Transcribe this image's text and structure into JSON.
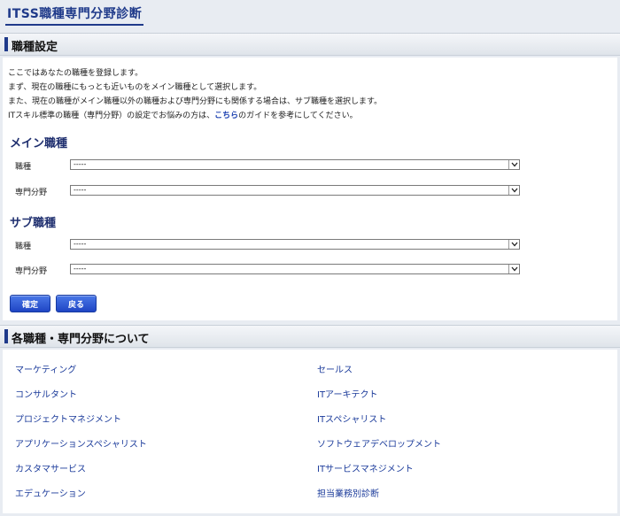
{
  "app": {
    "title": "ITSS職種専門分野診断"
  },
  "section1": {
    "heading": "職種設定",
    "intro": {
      "line1": "ここではあなたの職種を登録します。",
      "line2": "まず、現在の職種にもっとも近いものをメイン職種として選択します。",
      "line3": "また、現在の職種がメイン職種以外の職種および専門分野にも関係する場合は、サブ職種を選択します。",
      "line4_pre": "ITスキル標準の職種（専門分野）の設定でお悩みの方は、",
      "line4_link": "こちら",
      "line4_post": "のガイドを参考にしてください。"
    },
    "main": {
      "title": "メイン職種",
      "job_label": "職種",
      "job_value": "-----",
      "field_label": "専門分野",
      "field_value": "-----"
    },
    "sub": {
      "title": "サブ職種",
      "job_label": "職種",
      "job_value": "-----",
      "field_label": "専門分野",
      "field_value": "-----"
    },
    "confirm_label": "確定",
    "back_label": "戻る"
  },
  "section2": {
    "heading": "各職種・専門分野について",
    "left_links": [
      "マーケティング",
      "コンサルタント",
      "プロジェクトマネジメント",
      "アプリケーションスペシャリスト",
      "カスタマサービス",
      "エデュケーション"
    ],
    "right_links": [
      "セールス",
      "ITアーキテクト",
      "ITスペシャリスト",
      "ソフトウェアデベロップメント",
      "ITサービスマネジメント",
      "担当業務別診断"
    ]
  },
  "colors": {
    "accent": "#1f3a8a",
    "button": "#2b55d6",
    "link": "#1a3a9a"
  }
}
